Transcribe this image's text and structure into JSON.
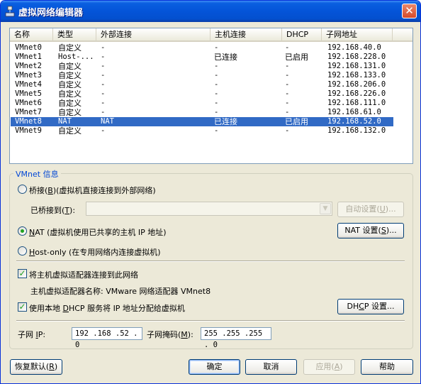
{
  "window": {
    "title": "虚拟网络编辑器",
    "close": "✕"
  },
  "list": {
    "headers": [
      "名称",
      "类型",
      "外部连接",
      "主机连接",
      "DHCP",
      "子网地址"
    ],
    "rows": [
      {
        "name": "VMnet0",
        "type": "自定义",
        "ext": "-",
        "host": "-",
        "dhcp": "-",
        "subnet": "192.168.40.0"
      },
      {
        "name": "VMnet1",
        "type": "Host-...",
        "ext": "-",
        "host": "已连接",
        "dhcp": "已启用",
        "subnet": "192.168.228.0"
      },
      {
        "name": "VMnet2",
        "type": "自定义",
        "ext": "-",
        "host": "-",
        "dhcp": "-",
        "subnet": "192.168.131.0"
      },
      {
        "name": "VMnet3",
        "type": "自定义",
        "ext": "-",
        "host": "-",
        "dhcp": "-",
        "subnet": "192.168.133.0"
      },
      {
        "name": "VMnet4",
        "type": "自定义",
        "ext": "-",
        "host": "-",
        "dhcp": "-",
        "subnet": "192.168.206.0"
      },
      {
        "name": "VMnet5",
        "type": "自定义",
        "ext": "-",
        "host": "-",
        "dhcp": "-",
        "subnet": "192.168.226.0"
      },
      {
        "name": "VMnet6",
        "type": "自定义",
        "ext": "-",
        "host": "-",
        "dhcp": "-",
        "subnet": "192.168.111.0"
      },
      {
        "name": "VMnet7",
        "type": "自定义",
        "ext": "-",
        "host": "-",
        "dhcp": "-",
        "subnet": "192.168.61.0"
      },
      {
        "name": "VMnet8",
        "type": "NAT",
        "ext": "NAT",
        "host": "已连接",
        "dhcp": "已启用",
        "subnet": "192.168.52.0",
        "selected": true
      },
      {
        "name": "VMnet9",
        "type": "自定义",
        "ext": "-",
        "host": "-",
        "dhcp": "-",
        "subnet": "192.168.132.0"
      }
    ]
  },
  "vmnet_info": {
    "legend": "VMnet 信息",
    "bridge": {
      "label_pre": "桥接(",
      "key": "B",
      "label_post": ")(虚拟机直接连接到外部网络)",
      "selected": false
    },
    "bridged_to": {
      "label_pre": "已桥接到(",
      "key": "T",
      "label_post": "):",
      "value": ""
    },
    "auto_settings": {
      "label_pre": "自动设置(",
      "key": "U",
      "label_post": ")..."
    },
    "nat": {
      "key": "N",
      "label_post": "AT (虚拟机使用已共享的主机 IP 地址)",
      "selected": true
    },
    "nat_settings": {
      "label_pre": "NAT 设置(",
      "key": "S",
      "label_post": ")..."
    },
    "hostonly": {
      "key": "H",
      "label_post": "ost-only (在专用网络内连接虚拟机)",
      "selected": false
    },
    "connect_adapter": {
      "label": "将主机虚拟适配器连接到此网络",
      "checked": true
    },
    "adapter_name": "主机虚拟适配器名称: VMware 网络适配器 VMnet8",
    "use_dhcp": {
      "label_pre": "使用本地 ",
      "key": "D",
      "label_post": "HCP 服务将 IP 地址分配给虚拟机",
      "checked": true
    },
    "dhcp_settings": {
      "label_pre": "DH",
      "key": "C",
      "label_post": "P 设置..."
    },
    "subnet_ip": {
      "label_pre": "子网 ",
      "key": "I",
      "label_post": "P:",
      "value": "192 .168 .52 . 0"
    },
    "subnet_mask": {
      "label_pre": "子网掩码(",
      "key": "M",
      "label_post": "):",
      "value": "255 .255 .255 . 0"
    }
  },
  "buttons": {
    "restore": {
      "label_pre": "恢复默认(",
      "key": "R",
      "label_post": ")"
    },
    "ok": "确定",
    "cancel": "取消",
    "apply": {
      "label_pre": "应用(",
      "key": "A",
      "label_post": ")"
    },
    "help": "帮助"
  }
}
